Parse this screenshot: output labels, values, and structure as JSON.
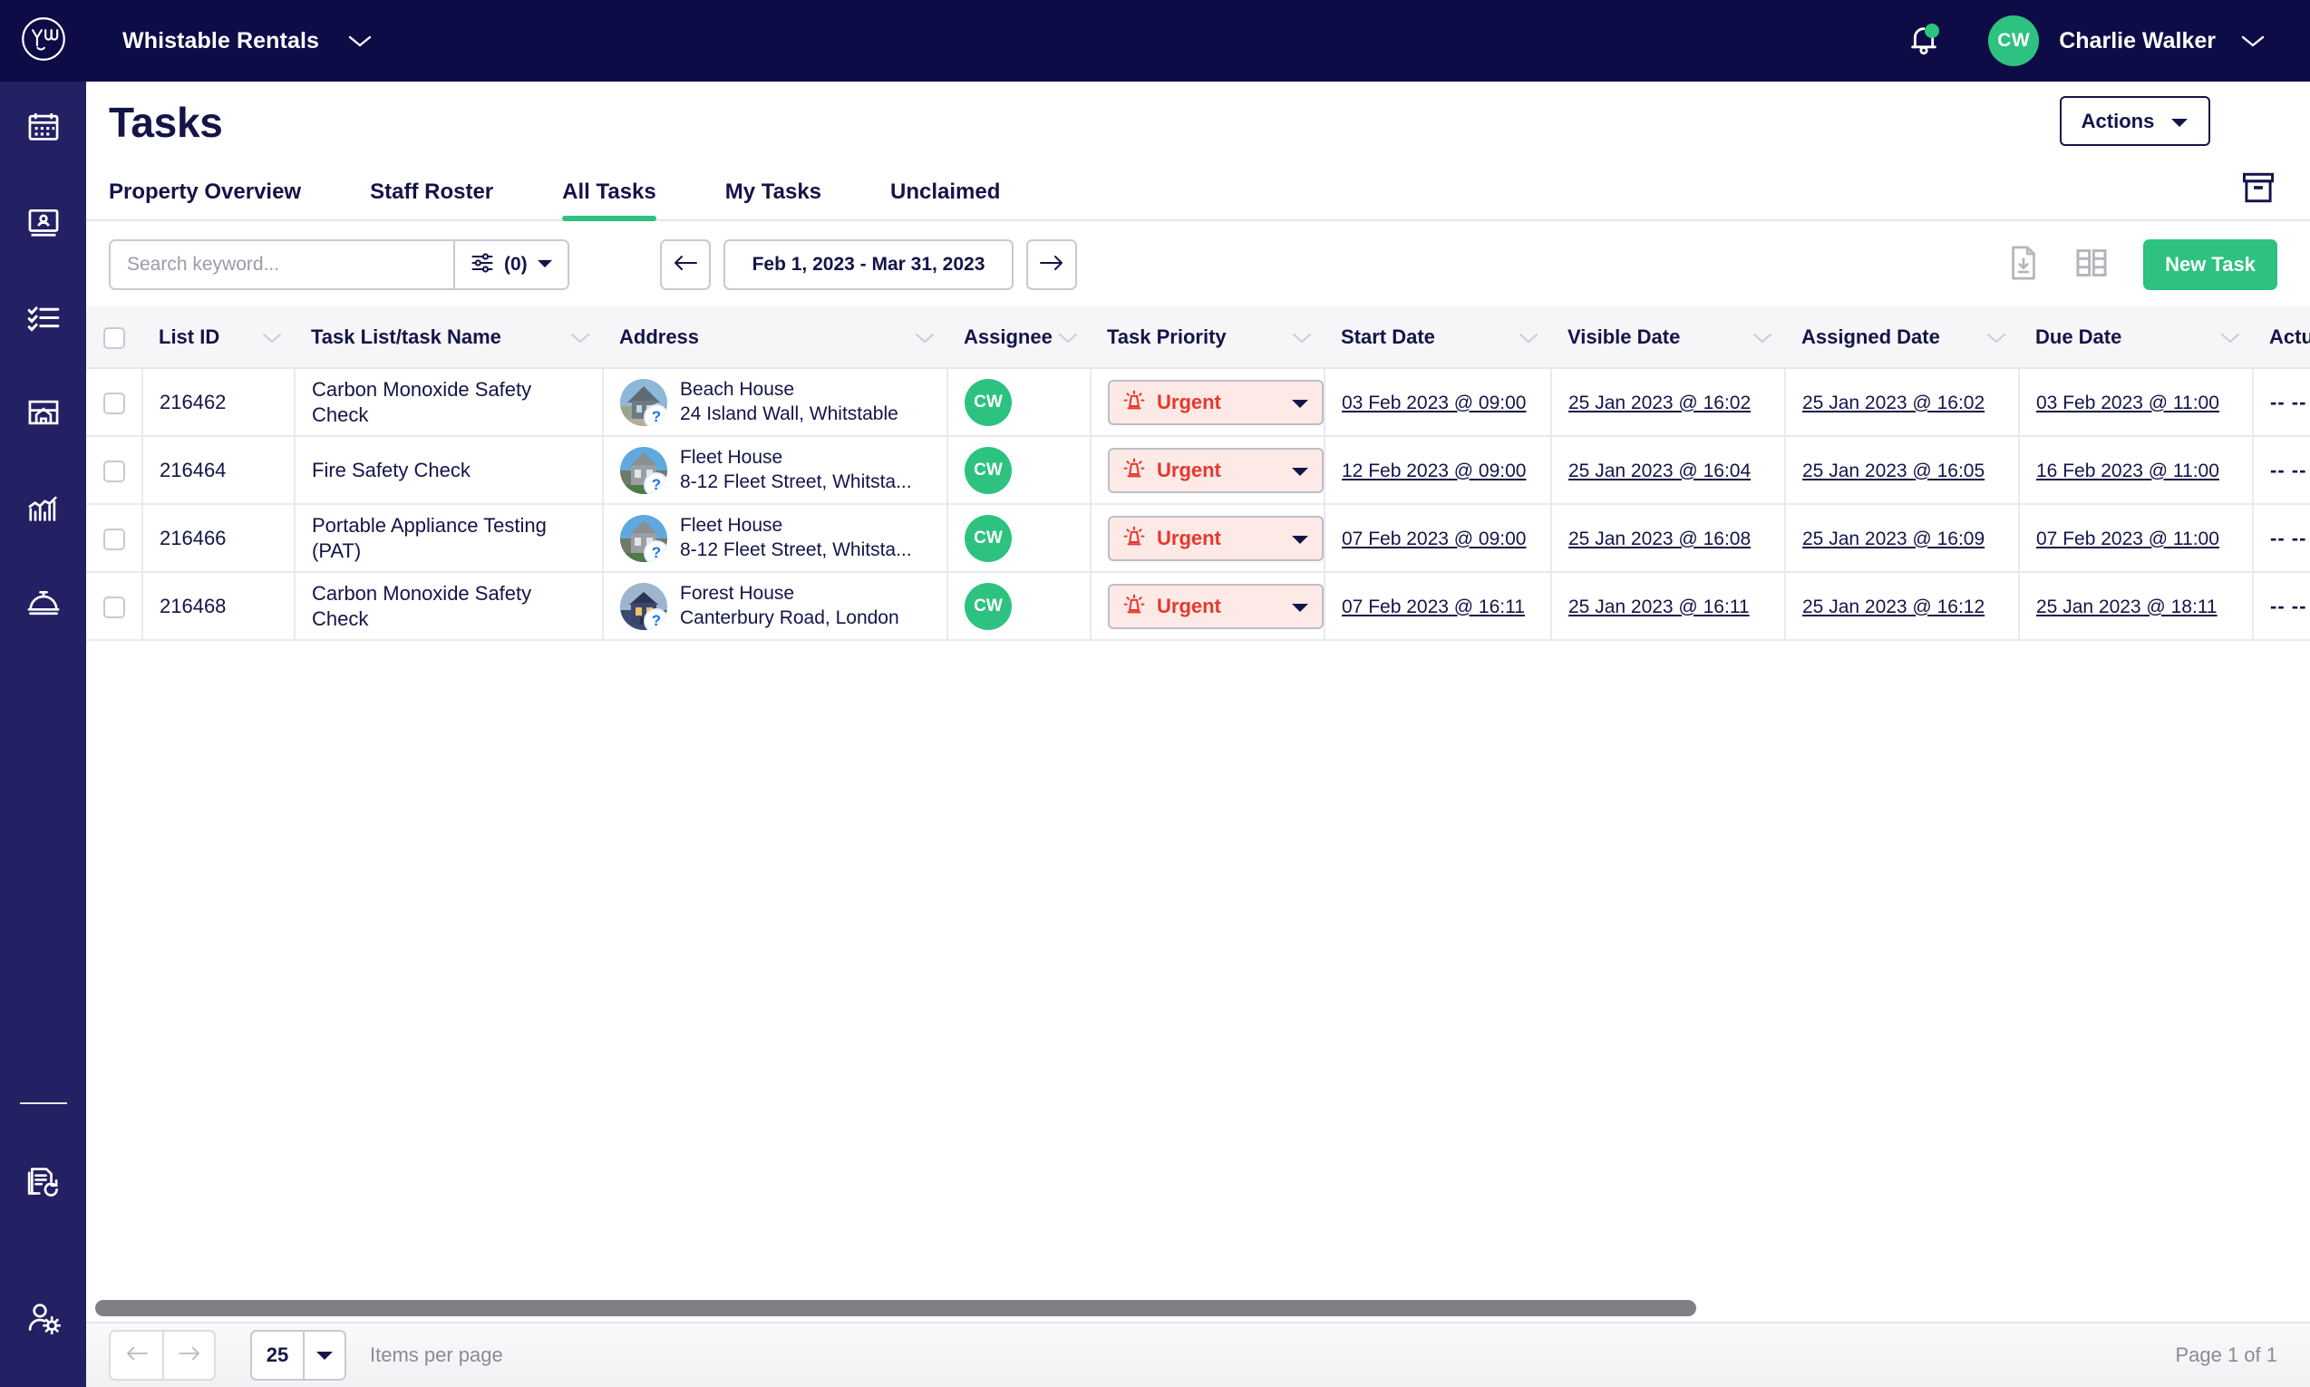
{
  "topbar": {
    "logo_icon": "yw-smiley-logo",
    "org_name": "Whistable Rentals",
    "org_caret_icon": "chevron-down-icon",
    "bell_icon": "notification-bell-icon",
    "user_initials": "CW",
    "user_name": "Charlie Walker",
    "user_caret_icon": "chevron-down-icon"
  },
  "rail": {
    "items": [
      {
        "icon": "calendar-icon",
        "name": "calendar"
      },
      {
        "icon": "contact-card-icon",
        "name": "staff"
      },
      {
        "icon": "checklist-icon",
        "name": "tasks"
      },
      {
        "icon": "property-icon",
        "name": "properties"
      },
      {
        "icon": "bar-chart-icon",
        "name": "reports"
      },
      {
        "icon": "service-bell-icon",
        "name": "services"
      }
    ],
    "bottom_items": [
      {
        "icon": "document-refresh-icon",
        "name": "audit-log"
      },
      {
        "icon": "user-settings-icon",
        "name": "account-settings"
      }
    ]
  },
  "page": {
    "title": "Tasks",
    "actions_label": "Actions",
    "actions_caret_icon": "caret-down-icon",
    "archive_icon": "archive-box-icon"
  },
  "tabs": [
    {
      "label": "Property Overview",
      "active": false
    },
    {
      "label": "Staff Roster",
      "active": false
    },
    {
      "label": "All Tasks",
      "active": true
    },
    {
      "label": "My Tasks",
      "active": false
    },
    {
      "label": "Unclaimed",
      "active": false
    }
  ],
  "toolbar": {
    "search_placeholder": "Search keyword...",
    "search_value": "",
    "filter_icon": "sliders-filter-icon",
    "filter_count": "(0)",
    "filter_caret_icon": "caret-down-icon",
    "date_prev_icon": "arrow-left-icon",
    "date_range": "Feb 1, 2023 - Mar 31, 2023",
    "date_next_icon": "arrow-right-icon",
    "export_icon": "file-download-icon",
    "columns_icon": "columns-layout-icon",
    "new_task_label": "New Task"
  },
  "table": {
    "select_all_checkbox": false,
    "sort_caret_icon": "chevron-down-icon",
    "columns": [
      "List ID",
      "Task List/task Name",
      "Address",
      "Assignee",
      "Task Priority",
      "Start Date",
      "Visible Date",
      "Assigned Date",
      "Due Date",
      "Actual"
    ],
    "rows": [
      {
        "checked": false,
        "list_id": "216462",
        "task_name": "Carbon Monoxide Safety Check",
        "property_name": "Beach House",
        "address": "24 Island Wall, Whitstable",
        "property_thumb": "beach-house-photo",
        "info_badge": "?",
        "assignee_initials": "CW",
        "priority": "Urgent",
        "priority_icon": "alarm-icon",
        "priority_caret_icon": "caret-down-icon",
        "start_date": "03 Feb 2023 @ 09:00",
        "visible_date": "25 Jan 2023 @ 16:02",
        "assigned_date": "25 Jan 2023 @ 16:02",
        "due_date": "03 Feb 2023 @ 11:00",
        "actual": "-- --"
      },
      {
        "checked": false,
        "list_id": "216464",
        "task_name": "Fire Safety Check",
        "property_name": "Fleet House",
        "address": "8-12 Fleet Street, Whitsta...",
        "property_thumb": "fleet-house-photo",
        "info_badge": "?",
        "assignee_initials": "CW",
        "priority": "Urgent",
        "priority_icon": "alarm-icon",
        "priority_caret_icon": "caret-down-icon",
        "start_date": "12 Feb 2023 @ 09:00",
        "visible_date": "25 Jan 2023 @ 16:04",
        "assigned_date": "25 Jan 2023 @ 16:05",
        "due_date": "16 Feb 2023 @ 11:00",
        "actual": "-- --"
      },
      {
        "checked": false,
        "list_id": "216466",
        "task_name": "Portable Appliance Testing (PAT)",
        "property_name": "Fleet House",
        "address": "8-12 Fleet Street, Whitsta...",
        "property_thumb": "fleet-house-photo",
        "info_badge": "?",
        "assignee_initials": "CW",
        "priority": "Urgent",
        "priority_icon": "alarm-icon",
        "priority_caret_icon": "caret-down-icon",
        "start_date": "07 Feb 2023 @ 09:00",
        "visible_date": "25 Jan 2023 @ 16:08",
        "assigned_date": "25 Jan 2023 @ 16:09",
        "due_date": "07 Feb 2023 @ 11:00",
        "actual": "-- --"
      },
      {
        "checked": false,
        "list_id": "216468",
        "task_name": "Carbon Monoxide Safety Check",
        "property_name": "Forest House",
        "address": "Canterbury Road, London",
        "property_thumb": "forest-house-photo",
        "info_badge": "?",
        "assignee_initials": "CW",
        "priority": "Urgent",
        "priority_icon": "alarm-icon",
        "priority_caret_icon": "caret-down-icon",
        "start_date": "07 Feb 2023 @ 16:11",
        "visible_date": "25 Jan 2023 @ 16:11",
        "assigned_date": "25 Jan 2023 @ 16:12",
        "due_date": "25 Jan 2023 @ 18:11",
        "actual": "-- --"
      }
    ]
  },
  "footer": {
    "prev_icon": "arrow-left-icon",
    "next_icon": "arrow-right-icon",
    "items_per_page_value": "25",
    "items_per_page_caret_icon": "caret-down-icon",
    "items_per_page_label": "Items per page",
    "page_indicator": "Page 1 of 1"
  },
  "colors": {
    "navy_dark": "#0d0c47",
    "navy_rail": "#232063",
    "green_accent": "#2dc27f",
    "urgent_red": "#e8372c",
    "urgent_bg": "#fdeae6",
    "text_navy": "#141449"
  }
}
